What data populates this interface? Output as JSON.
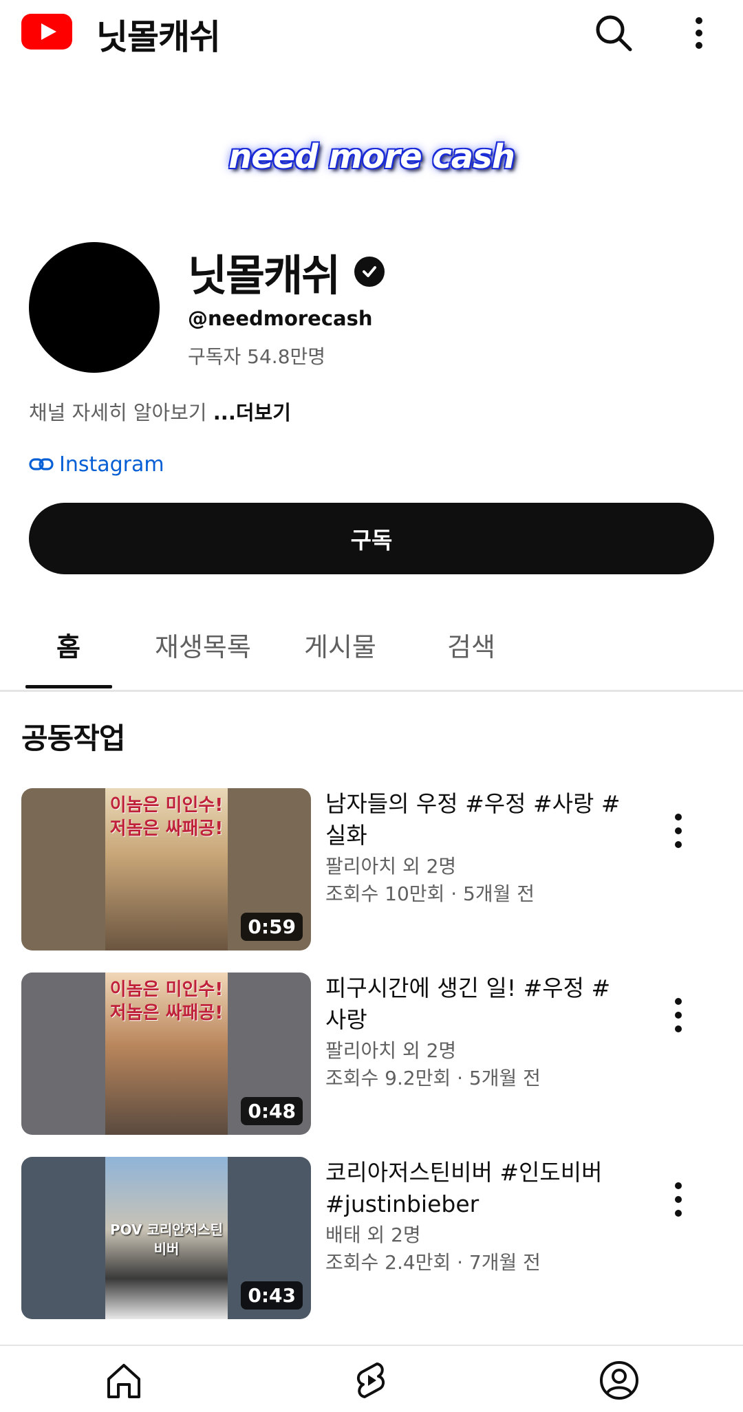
{
  "topbar": {
    "title": "닛몰캐쉬",
    "logo_icon": "youtube-logo-icon",
    "search_icon": "search-icon",
    "more_icon": "more-vert-icon"
  },
  "banner": {
    "text": "need more cash"
  },
  "channel": {
    "name": "닛몰캐쉬",
    "handle": "@needmorecash",
    "subscribers": "구독자 54.8만명",
    "description": "채널 자세히 알아보기 ",
    "more_label": "...더보기",
    "link_label": "Instagram",
    "subscribe_label": "구독"
  },
  "tabs": [
    {
      "label": "홈",
      "active": true
    },
    {
      "label": "재생목록",
      "active": false
    },
    {
      "label": "게시물",
      "active": false
    },
    {
      "label": "검색",
      "active": false
    }
  ],
  "section": {
    "title": "공동작업"
  },
  "videos": [
    {
      "title": "남자들의 우정 #우정 #사랑 #실화",
      "author": "팔리아치 외 2명",
      "meta": "조회수 10만회 · 5개월 전",
      "duration": "0:59",
      "bg": "#7a6a55",
      "thumb_text_top": "이놈은 미인수! 저놈은 싸패공!"
    },
    {
      "title": "피구시간에 생긴 일! #우정 #사랑",
      "author": "팔리아치 외 2명",
      "meta": "조회수 9.2만회 · 5개월 전",
      "duration": "0:48",
      "bg": "#6b6b70",
      "thumb_text_top": "이놈은 미인수! 저놈은 싸패공!"
    },
    {
      "title": "코리아저스틴비버 #인도비버 #justinbieber",
      "author": "배태 외 2명",
      "meta": "조회수 2.4만회 · 7개월 전",
      "duration": "0:43",
      "bg": "#4d5866",
      "thumb_text_top": "POV 코리안저스틴비버"
    }
  ],
  "colors": {
    "accent": "#ff0000",
    "link": "#065fd4",
    "secondary_text": "#606060",
    "button": "#0f0f0f"
  },
  "bottom_nav": [
    {
      "icon": "home-icon"
    },
    {
      "icon": "shorts-icon"
    },
    {
      "icon": "account-icon"
    }
  ]
}
